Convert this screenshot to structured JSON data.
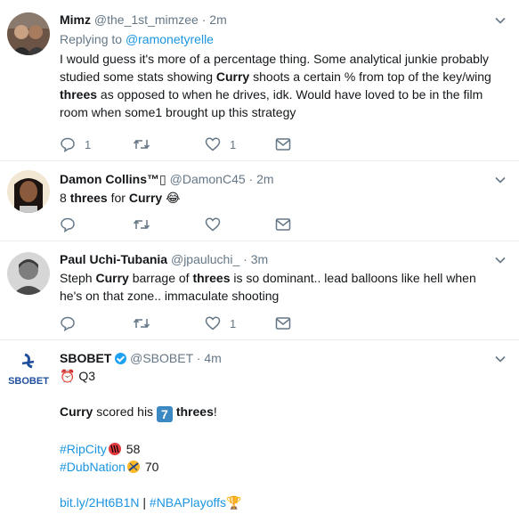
{
  "tweets": [
    {
      "name": "Mimz",
      "handle": "@the_1st_mimzee",
      "dot": "·",
      "time": "2m",
      "replying_prefix": "Replying to",
      "replying_to": "@ramonetyrelle",
      "text": {
        "p1": "I would guess it's more of a percentage thing. Some analytical junkie probably studied some stats showing ",
        "b1": "Curry",
        "p2": " shoots a certain %  from top of the key/wing ",
        "b2": "threes",
        "p3": " as opposed to when he drives, idk. Would have loved to be in the film room when some1 brought up this strategy"
      },
      "reply_count": "1",
      "retweet_count": "",
      "like_count": "1"
    },
    {
      "name": "Damon Collins™",
      "name_suffix": "▯",
      "handle": "@DamonC45",
      "dot": "·",
      "time": "2m",
      "text": {
        "p1": "8 ",
        "b1": "threes",
        "p2": " for ",
        "b2": "Curry",
        "emoji": "😂"
      },
      "reply_count": "",
      "retweet_count": "",
      "like_count": ""
    },
    {
      "name": "Paul Uchi-Tubania",
      "handle": "@jpauluchi_",
      "dot": "·",
      "time": "3m",
      "text": {
        "p1": "Steph ",
        "b1": "Curry",
        "p2": " barrage of ",
        "b2": "threes",
        "p3": " is so dominant.. lead balloons like hell when he's on that zone.. immaculate shooting"
      },
      "reply_count": "",
      "retweet_count": "",
      "like_count": "1"
    },
    {
      "name": "SBOBET",
      "handle": "@SBOBET",
      "dot": "·",
      "time": "4m",
      "logo_text": "SBOBET",
      "alarm_emoji": "⏰",
      "line1": "Q3",
      "b1": "Curry",
      "p1": " scored his ",
      "num": "7",
      "b2": "threes",
      "p2": "!",
      "tag1": "#RipCity",
      "score1": "58",
      "tag2": "#DubNation",
      "score2": "70",
      "url": "bit.ly/2Ht6B1N",
      "sep": " | ",
      "tag3": "#NBAPlayoffs",
      "trophy_emoji": "🏆"
    }
  ]
}
